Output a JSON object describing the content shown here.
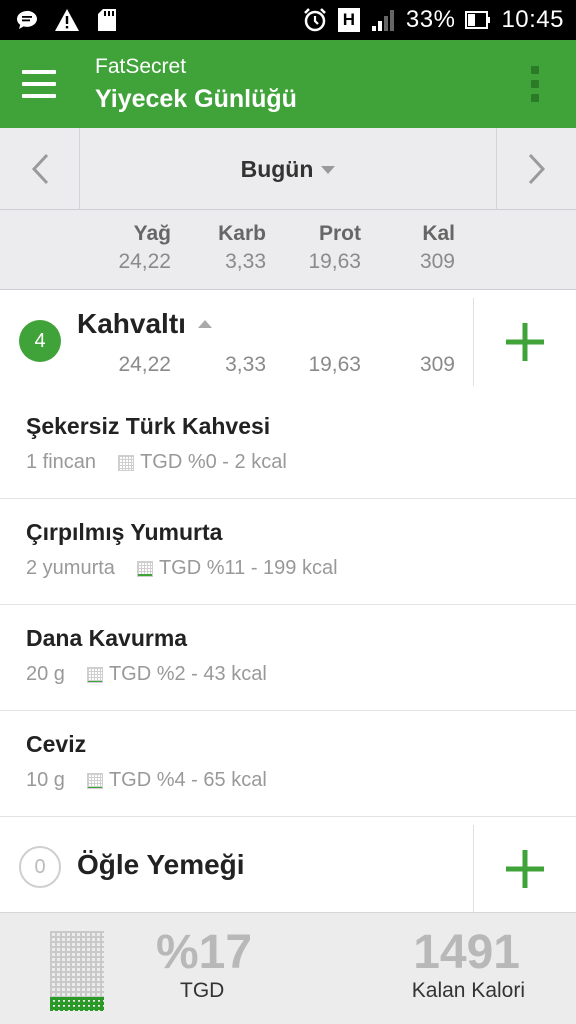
{
  "status_bar": {
    "icons_left": [
      "message-icon",
      "warning-icon",
      "sd-card-icon"
    ],
    "icons_right": [
      "alarm-icon",
      "hspa-icon",
      "signal-icon",
      "battery-icon"
    ],
    "network_label": "H",
    "battery": "33%",
    "time": "10:45"
  },
  "app_bar": {
    "app_name": "FatSecret",
    "title": "Yiyecek Günlüğü",
    "menu_icon": "hamburger-icon",
    "overflow_icon": "overflow-menu-icon",
    "color": "#3fa33a"
  },
  "date_nav": {
    "label": "Bugün",
    "prev_icon": "chevron-left-icon",
    "next_icon": "chevron-right-icon"
  },
  "totals": {
    "headers": {
      "fat": "Yağ",
      "carb": "Karb",
      "prot": "Prot",
      "kal": "Kal"
    },
    "values": {
      "fat": "24,22",
      "carb": "3,33",
      "prot": "19,63",
      "kal": "309"
    }
  },
  "meals": [
    {
      "count": "4",
      "name": "Kahvaltı",
      "values": {
        "fat": "24,22",
        "carb": "3,33",
        "prot": "19,63",
        "kal": "309"
      },
      "foods": [
        {
          "name": "Şekersiz Türk Kahvesi",
          "amount": "1  fincan",
          "rdi_pct": 0,
          "rdi": "TGD %0 - 2 kcal"
        },
        {
          "name": "Çırpılmış Yumurta",
          "amount": "2  yumurta",
          "rdi_pct": 11,
          "rdi": "TGD %11 - 199 kcal"
        },
        {
          "name": "Dana Kavurma",
          "amount": "20  g",
          "rdi_pct": 2,
          "rdi": "TGD %2 - 43 kcal"
        },
        {
          "name": "Ceviz",
          "amount": "10  g",
          "rdi_pct": 4,
          "rdi": "TGD %4 - 65 kcal"
        }
      ]
    },
    {
      "count": "0",
      "name": "Öğle Yemeği"
    }
  ],
  "summary": {
    "rdi_percent": "%17",
    "rdi_label": "TGD",
    "rdi_fill_fraction": 0.17,
    "remaining": "1491",
    "remaining_label": "Kalan Kalori"
  }
}
